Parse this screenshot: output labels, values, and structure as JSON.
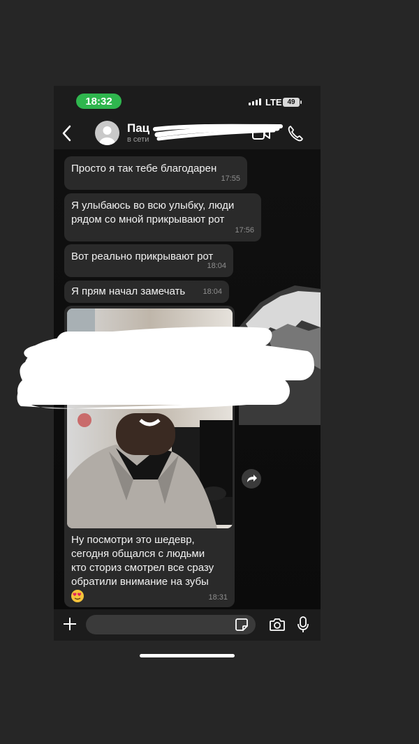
{
  "status_bar": {
    "time": "18:32",
    "network": "LTE",
    "battery": "49",
    "colors": {
      "time_pill": "#2fb64e"
    }
  },
  "header": {
    "contact_name": "Пац",
    "contact_status": "в сети",
    "icons": [
      "back-icon",
      "avatar",
      "video-call-icon",
      "phone-icon"
    ]
  },
  "messages": [
    {
      "text": "Просто я так тебе благодарен",
      "time": "17:55"
    },
    {
      "text_lines": [
        "Я улыбаюсь во всю улыбку, люди",
        "рядом со мной прикрывают рот"
      ],
      "time": "17:56"
    },
    {
      "text": "Вот реально прикрывают рот",
      "time": "18:04"
    },
    {
      "text": "Я прям начал замечать",
      "time": "18:04"
    }
  ],
  "photo_message": {
    "caption_lines": [
      "Ну посмотри это шедевр,",
      "сегодня общался с людьми",
      "кто сториз смотрел все сразу",
      "обратили внимание на зубы"
    ],
    "emoji": "heart-eyes-emoji",
    "time": "18:31"
  },
  "input_bar": {
    "placeholder": "",
    "icons": [
      "plus-icon",
      "sticker-icon",
      "camera-icon",
      "microphone-icon"
    ]
  },
  "colors": {
    "background": "#262626",
    "bubble": "#2a2a2a",
    "bar": "#1c1c1c"
  }
}
